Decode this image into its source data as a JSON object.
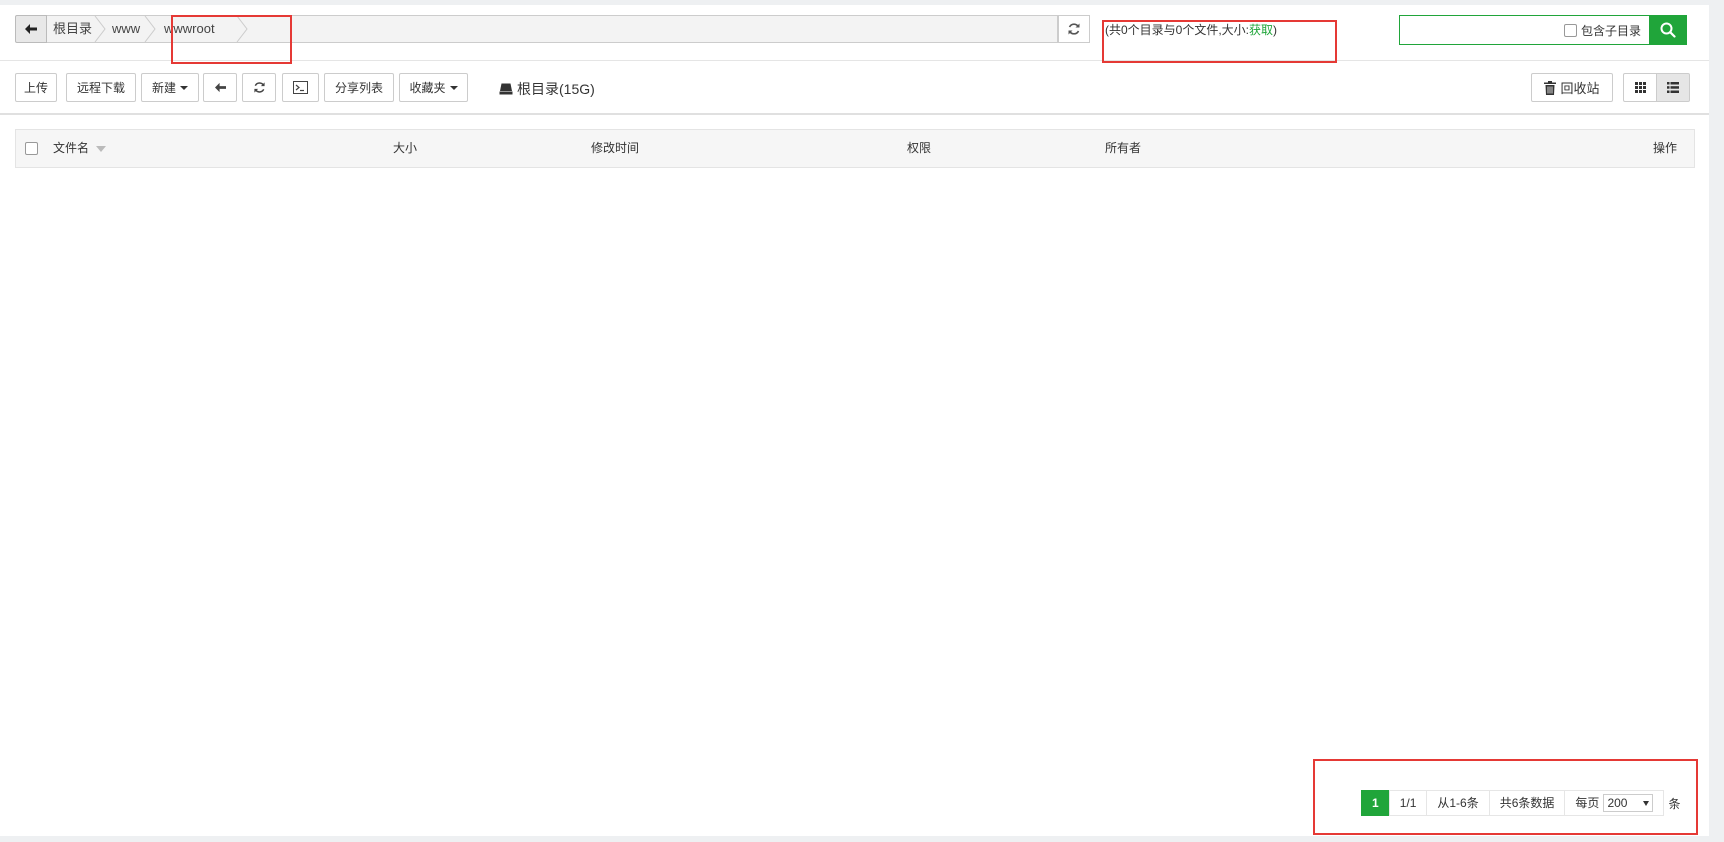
{
  "pathbar": {
    "crumbs": [
      "根目录",
      "www",
      "wwwroot"
    ],
    "summary_text": "(共0个目录与0个文件,大小:",
    "summary_link": "获取",
    "summary_close": ")"
  },
  "search": {
    "value": "",
    "include_subdirs_label": "包含子目录"
  },
  "toolbar": {
    "upload": "上传",
    "remote_download": "远程下载",
    "new": "新建",
    "share_list": "分享列表",
    "favorites": "收藏夹",
    "disk_label": "根目录(15G)",
    "recycle_bin": "回收站"
  },
  "table": {
    "columns": [
      "文件名",
      "大小",
      "修改时间",
      "权限",
      "所有者",
      "操作"
    ],
    "rows": []
  },
  "pagination": {
    "current_page": "1",
    "page_of": "1/1",
    "range": "从1-6条",
    "total": "共6条数据",
    "per_page_label": "每页",
    "per_page_value": "200",
    "per_page_unit": "条"
  },
  "colors": {
    "accent": "#20a53a",
    "annotation": "#e53935"
  }
}
